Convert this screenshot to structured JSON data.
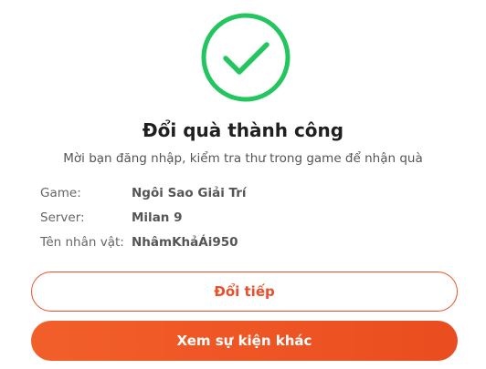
{
  "status_icon": {
    "name": "check-circle-icon",
    "color": "#22c55e"
  },
  "dialog": {
    "title": "Đổi quà thành công",
    "subtitle": "Mời bạn đăng nhập, kiểm tra thư trong game để nhận quà"
  },
  "details": [
    {
      "label": "Game:",
      "value": "Ngôi Sao Giải Trí"
    },
    {
      "label": "Server:",
      "value": "Milan 9"
    },
    {
      "label": "Tên nhân vật:",
      "value": "NhâmKhảÁi950"
    }
  ],
  "actions": {
    "continue_label": "Đổi tiếp",
    "more_events_label": "Xem sự kiện khác"
  },
  "colors": {
    "accent": "#e8502b",
    "success": "#22c55e"
  }
}
